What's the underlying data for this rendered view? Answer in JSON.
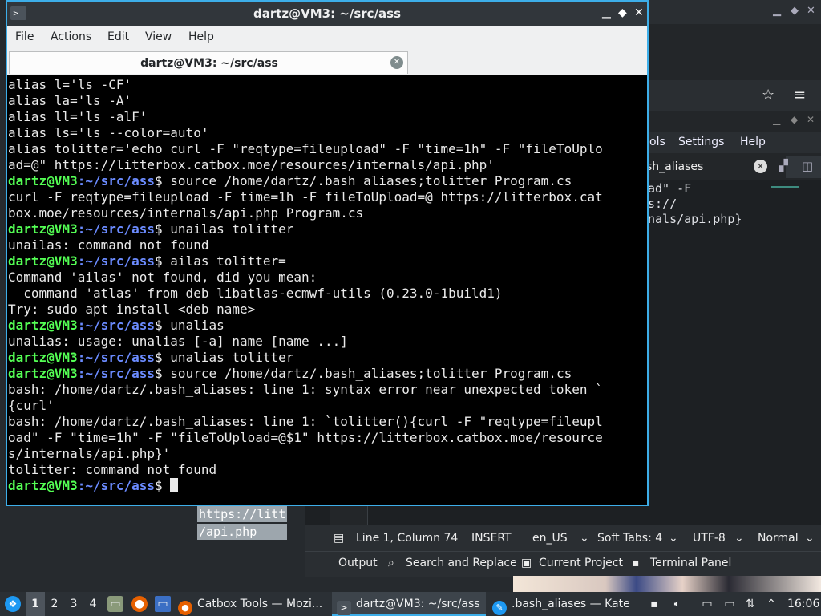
{
  "terminal": {
    "window_title": "dartz@VM3: ~/src/ass",
    "menu": [
      "File",
      "Actions",
      "Edit",
      "View",
      "Help"
    ],
    "tab_title": "dartz@VM3: ~/src/ass",
    "prompt_user": "dartz@VM3",
    "prompt_path": ":~/src/ass",
    "prompt_sign": "$ ",
    "lines": [
      {
        "text": "alias l='ls -CF'"
      },
      {
        "text": "alias la='ls -A'"
      },
      {
        "text": "alias ll='ls -alF'"
      },
      {
        "text": "alias ls='ls --color=auto'"
      },
      {
        "text": "alias tolitter='echo curl -F \"reqtype=fileupload\" -F \"time=1h\" -F \"fileToUplo"
      },
      {
        "text": "ad=@\" https://litterbox.catbox.moe/resources/internals/api.php'"
      },
      {
        "prompt": true,
        "text": "source /home/dartz/.bash_aliases;tolitter Program.cs"
      },
      {
        "text": "curl -F reqtype=fileupload -F time=1h -F fileToUpload=@ https://litterbox.cat"
      },
      {
        "text": "box.moe/resources/internals/api.php Program.cs"
      },
      {
        "prompt": true,
        "text": "unailas tolitter"
      },
      {
        "text": "unailas: command not found"
      },
      {
        "prompt": true,
        "text": "ailas tolitter="
      },
      {
        "text": "Command 'ailas' not found, did you mean:"
      },
      {
        "text": "  command 'atlas' from deb libatlas-ecmwf-utils (0.23.0-1build1)"
      },
      {
        "text": "Try: sudo apt install <deb name>"
      },
      {
        "prompt": true,
        "text": "unalias"
      },
      {
        "text": "unalias: usage: unalias [-a] name [name ...]"
      },
      {
        "prompt": true,
        "text": "unalias tolitter"
      },
      {
        "prompt": true,
        "text": "source /home/dartz/.bash_aliases;tolitter Program.cs"
      },
      {
        "text": "bash: /home/dartz/.bash_aliases: line 1: syntax error near unexpected token `"
      },
      {
        "text": "{curl'"
      },
      {
        "text": "bash: /home/dartz/.bash_aliases: line 1: `tolitter(){curl -F \"reqtype=fileupl"
      },
      {
        "text": "oad\" -F \"time=1h\" -F \"fileToUpload=@$1\" https://litterbox.catbox.moe/resource"
      },
      {
        "text": "s/internals/api.php}'"
      },
      {
        "text": "tolitter: command not found"
      },
      {
        "prompt": true,
        "text": "",
        "cursor": true
      }
    ]
  },
  "kate": {
    "menu": [
      "ols",
      "Settings",
      "Help"
    ],
    "tab_label": "sh_aliases",
    "code": [
      "ad\" -F",
      "s://",
      "nals/api.php}"
    ],
    "status": {
      "position": "Line 1, Column 74",
      "mode": "INSERT",
      "language": "en_US",
      "indent": "Soft Tabs: 4",
      "encoding": "UTF-8",
      "highlight": "Normal"
    },
    "bottom_tabs": [
      "Output",
      "Search and Replace",
      "Current Project",
      "Terminal Panel"
    ]
  },
  "desktop_peek": [
    "https://litt",
    "/api.php"
  ],
  "taskbar": {
    "desktops": [
      "1",
      "2",
      "3",
      "4"
    ],
    "tasks": [
      "Catbox Tools — Mozi...",
      "dartz@VM3: ~/src/ass",
      ".bash_aliases — Kate"
    ],
    "clock": "16:06"
  },
  "colors": {
    "accent": "#3daee9",
    "prompt_user": "#54ff54",
    "prompt_path": "#6b8bff"
  }
}
